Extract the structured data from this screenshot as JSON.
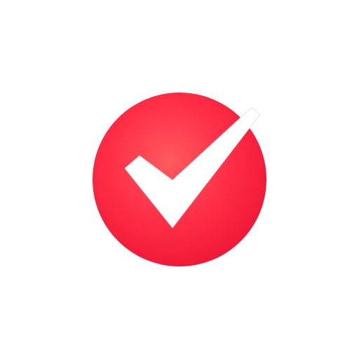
{
  "colors": {
    "background": "#ffffff",
    "badge_center": "#ff5a60",
    "badge_mid": "#ff2f45",
    "badge_edge": "#f01838",
    "checkmark_fill": "#ffffff",
    "checkmark_outline": "#e0e0e0"
  },
  "icons": {
    "badge": "red-circle-badge",
    "mark": "checkmark-icon"
  }
}
